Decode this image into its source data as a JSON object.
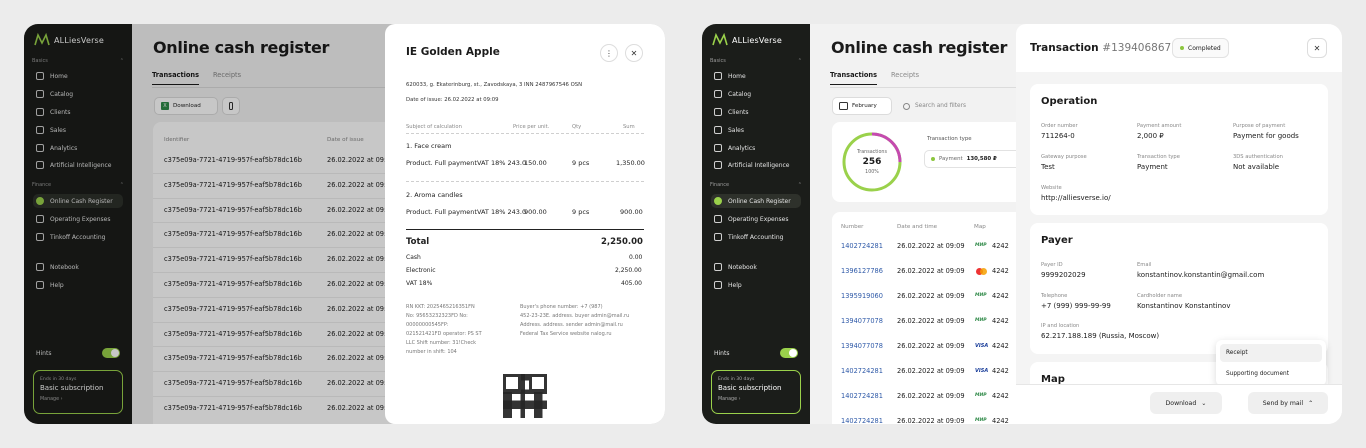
{
  "sidebar": {
    "brand": "ALLiesVerse",
    "section_basics": "Basics",
    "section_finance": "Finance",
    "items": [
      "Home",
      "Catalog",
      "Clients",
      "Sales",
      "Analytics",
      "Artificial Intelligence"
    ],
    "finance_items": [
      "Online Cash Register",
      "Operating Expenses",
      "Tinkoff Accounting"
    ],
    "other_items": [
      "Notebook",
      "Help"
    ],
    "hints_label": "Hints",
    "sub_ends": "Ends in 30 days",
    "sub_title": "Basic subscription",
    "sub_manage": "Manage"
  },
  "page": {
    "title": "Online cash register",
    "tab_transactions": "Transactions",
    "tab_receipts": "Receipts",
    "download": "Download",
    "february": "February",
    "search_placeholder": "Search and filters"
  },
  "left_table": {
    "col_identifier": "Identifier",
    "col_date": "Date of issue",
    "rows": [
      [
        "c375e09a-7721-4719-957f-eaf5b78dc16b",
        "26.02.2022 at 09:"
      ],
      [
        "c375e09a-7721-4719-957f-eaf5b78dc16b",
        "26.02.2022 at 09:"
      ],
      [
        "c375e09a-7721-4719-957f-eaf5b78dc16b",
        "26.02.2022 at 09:"
      ],
      [
        "c375e09a-7721-4719-957f-eaf5b78dc16b",
        "26.02.2022 at 09:"
      ],
      [
        "c375e09a-7721-4719-957f-eaf5b78dc16b",
        "26.02.2022 at 09:"
      ],
      [
        "c375e09a-7721-4719-957f-eaf5b78dc16b",
        "26.02.2022 at 09:"
      ],
      [
        "c375e09a-7721-4719-957f-eaf5b78dc16b",
        "26.02.2022 at 09:"
      ],
      [
        "c375e09a-7721-4719-957f-eaf5b78dc16b",
        "26.02.2022 at 09:"
      ],
      [
        "c375e09a-7721-4719-957f-eaf5b78dc16b",
        "26.02.2022 at 09:"
      ],
      [
        "c375e09a-7721-4719-957f-eaf5b78dc16b",
        "26.02.2022 at 09:"
      ],
      [
        "c375e09a-7721-4719-957f-eaf5b78dc16b",
        "26.02.2022 at 09:"
      ]
    ]
  },
  "receipt": {
    "title": "IE Golden Apple",
    "address": "620033, g. Ekaterinburg, st., Zavodskaya, 3 INN 2487967546 OSN",
    "date": "Date of issue: 26.02.2022 at 09:09",
    "col_subject": "Subject of calculation",
    "col_price": "Price per unit.",
    "col_qty": "Qty",
    "col_sum": "Sum",
    "items": [
      {
        "name": "1. Face cream",
        "desc": "Product. Full paymentVAT 18% 243.0",
        "price": "150.00",
        "qty": "9 pcs",
        "sum": "1,350.00"
      },
      {
        "name": "2. Aroma candles",
        "desc": "Product. Full paymentVAT 18% 243.0",
        "price": "900.00",
        "qty": "9 pcs",
        "sum": "900.00"
      }
    ],
    "total_label": "Total",
    "total": "2,250.00",
    "cash_label": "Cash",
    "cash": "0.00",
    "electronic_label": "Electronic",
    "electronic": "2,250.00",
    "vat_label": "VAT 18%",
    "vat": "405.00",
    "footer_left": [
      "RN KKT: 2025465216351FN",
      "No: 95653232323FD No:",
      "00000000545FP:",
      "021521421FD operator: PS ST",
      "LLC Shift number: 31!Check",
      "number in shift: 104"
    ],
    "footer_right": [
      "Buyer's phone number: +7 (987)",
      "452-23-23E. address. buyer admin@mail.ru",
      "Address. address. sender admin@mail.ru",
      "Federal Tax Service website nalog.ru"
    ]
  },
  "right": {
    "donut_label": "Transactions",
    "donut_value": "256",
    "donut_pct": "100%",
    "type_label": "Transaction type",
    "payment_label": "Payment",
    "payment_value": "130,580 ₽",
    "col_number": "Number",
    "col_datetime": "Date and time",
    "col_map": "Map",
    "rows": [
      {
        "num": "1402724281",
        "date": "26.02.2022 at 09:09",
        "card": "mir",
        "tail": "4242"
      },
      {
        "num": "1396127786",
        "date": "26.02.2022 at 09:09",
        "card": "mc",
        "tail": "4242"
      },
      {
        "num": "1395919060",
        "date": "26.02.2022 at 09:09",
        "card": "mir",
        "tail": "4242"
      },
      {
        "num": "1394077078",
        "date": "26.02.2022 at 09:09",
        "card": "mir",
        "tail": "4242"
      },
      {
        "num": "1394077078",
        "date": "26.02.2022 at 09:09",
        "card": "visa",
        "tail": "4242"
      },
      {
        "num": "1402724281",
        "date": "26.02.2022 at 09:09",
        "card": "visa",
        "tail": "4242"
      },
      {
        "num": "1402724281",
        "date": "26.02.2022 at 09:09",
        "card": "mir",
        "tail": "4242"
      },
      {
        "num": "1402724281",
        "date": "26.02.2022 at 09:09",
        "card": "mir",
        "tail": "4242"
      }
    ],
    "mir_text": "МИР",
    "visa_text": "VISA"
  },
  "transaction": {
    "title": "Transaction",
    "id": "#1394068675",
    "status": "Completed",
    "operation_title": "Operation",
    "order_number_label": "Order number",
    "order_number": "711264-0",
    "payment_amount_label": "Payment amount",
    "payment_amount": "2,000 ₽",
    "purpose_label": "Purpose of payment",
    "purpose": "Payment for goods",
    "gateway_label": "Gateway purpose",
    "gateway": "Test",
    "ttype_label": "Transaction type",
    "ttype": "Payment",
    "auth_label": "3DS authentication",
    "auth": "Not available",
    "website_label": "Website",
    "website": "http://alliesverse.io/",
    "payer_title": "Payer",
    "payer_id_label": "Payer ID",
    "payer_id": "9999202029",
    "email_label": "Email",
    "email": "konstantinov.konstantin@gmail.com",
    "phone_label": "Telephone",
    "phone": "+7 (999) 999-99-99",
    "holder_label": "Cardholder name",
    "holder": "Konstantinov Konstantinov",
    "ip_label": "IP and location",
    "ip": "62.217.188.189 (Russia, Moscow)",
    "map_title": "Map",
    "menu_receipt": "Receipt",
    "menu_supporting": "Supporting document",
    "download": "Download",
    "send_mail": "Send by mail"
  }
}
